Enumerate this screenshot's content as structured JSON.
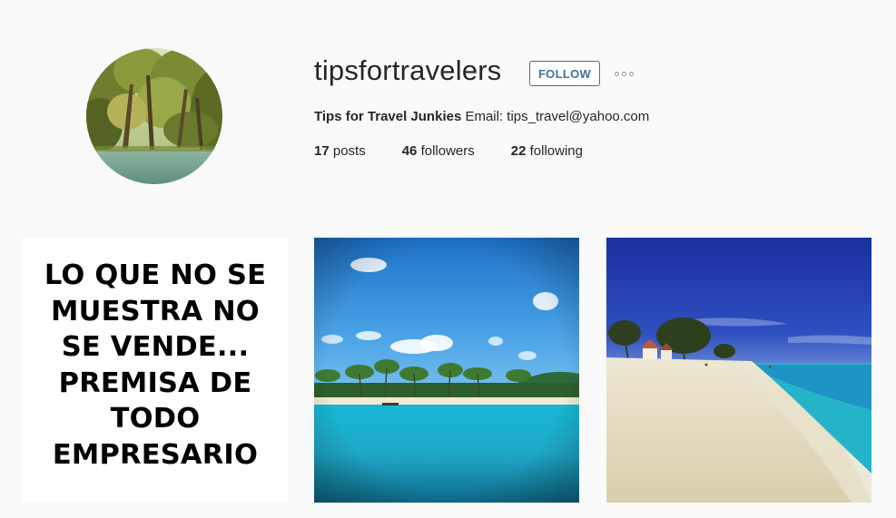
{
  "profile": {
    "username": "tipsfortravelers",
    "follow_label": "FOLLOW",
    "more_icon": "ellipsis-icon",
    "full_name": "Tips for Travel Junkies",
    "bio_text": " Email: tips_travel@yahoo.com",
    "stats": {
      "posts_count": "17",
      "posts_label": "posts",
      "followers_count": "46",
      "followers_label": "followers",
      "following_count": "22",
      "following_label": "following"
    }
  },
  "posts": [
    {
      "kind": "text-image",
      "lines": [
        "LO QUE NO SE",
        "MUESTRA NO",
        "SE VENDE...",
        "PREMISA DE",
        "TODO",
        "EMPRESARIO"
      ]
    },
    {
      "kind": "photo",
      "subject": "tropical-island-photo"
    },
    {
      "kind": "photo",
      "subject": "beach-photo"
    }
  ],
  "colors": {
    "background": "#fafafa",
    "accent": "#3f729b",
    "text": "#262626"
  }
}
